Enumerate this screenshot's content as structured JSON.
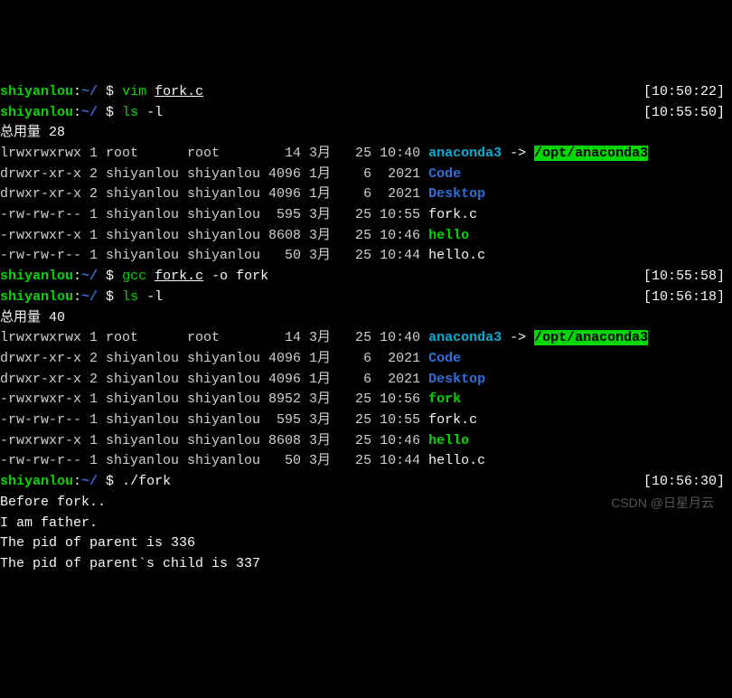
{
  "prompts": [
    {
      "user": "shiyanlou",
      "host": "",
      "path": "~/",
      "cmd": "vim",
      "arg_ul": "fork.c",
      "rest": "",
      "time": "[10:50:22]"
    },
    {
      "user": "shiyanlou",
      "host": "",
      "path": "~/",
      "cmd": "ls",
      "arg_ul": "",
      "rest": " -l",
      "time": "[10:55:50]"
    }
  ],
  "total1": "总用量 28",
  "ls1": [
    {
      "perm": "lrwxrwxrwx",
      "n": "1",
      "own": "root     ",
      "grp": "root     ",
      "size": "  14",
      "mon": "3月 ",
      "day": " 25",
      "tm": "10:40",
      "name": "anaconda3",
      "cls": "cyan",
      "arrow": " -> ",
      "target": "/opt/anaconda3",
      "tcls": "hl"
    },
    {
      "perm": "drwxr-xr-x",
      "n": "2",
      "own": "shiyanlou",
      "grp": "shiyanlou",
      "size": "4096",
      "mon": "1月 ",
      "day": "  6",
      "tm": " 2021",
      "name": "Code",
      "cls": "blue",
      "arrow": "",
      "target": "",
      "tcls": ""
    },
    {
      "perm": "drwxr-xr-x",
      "n": "2",
      "own": "shiyanlou",
      "grp": "shiyanlou",
      "size": "4096",
      "mon": "1月 ",
      "day": "  6",
      "tm": " 2021",
      "name": "Desktop",
      "cls": "blue",
      "arrow": "",
      "target": "",
      "tcls": ""
    },
    {
      "perm": "-rw-rw-r--",
      "n": "1",
      "own": "shiyanlou",
      "grp": "shiyanlou",
      "size": " 595",
      "mon": "3月 ",
      "day": " 25",
      "tm": "10:55",
      "name": "fork.c",
      "cls": "white",
      "arrow": "",
      "target": "",
      "tcls": ""
    },
    {
      "perm": "-rwxrwxr-x",
      "n": "1",
      "own": "shiyanlou",
      "grp": "shiyanlou",
      "size": "8608",
      "mon": "3月 ",
      "day": " 25",
      "tm": "10:46",
      "name": "hello",
      "cls": "green",
      "arrow": "",
      "target": "",
      "tcls": ""
    },
    {
      "perm": "-rw-rw-r--",
      "n": "1",
      "own": "shiyanlou",
      "grp": "shiyanlou",
      "size": "  50",
      "mon": "3月 ",
      "day": " 25",
      "tm": "10:44",
      "name": "hello.c",
      "cls": "white",
      "arrow": "",
      "target": "",
      "tcls": ""
    }
  ],
  "prompts2": [
    {
      "user": "shiyanlou",
      "path": "~/",
      "cmd": "gcc",
      "arg_ul": "fork.c",
      "rest": " -o fork",
      "time": "[10:55:58]"
    },
    {
      "user": "shiyanlou",
      "path": "~/",
      "cmd": "ls",
      "arg_ul": "",
      "rest": " -l",
      "time": "[10:56:18]"
    }
  ],
  "total2": "总用量 40",
  "ls2": [
    {
      "perm": "lrwxrwxrwx",
      "n": "1",
      "own": "root     ",
      "grp": "root     ",
      "size": "  14",
      "mon": "3月 ",
      "day": " 25",
      "tm": "10:40",
      "name": "anaconda3",
      "cls": "cyan",
      "arrow": " -> ",
      "target": "/opt/anaconda3",
      "tcls": "hl"
    },
    {
      "perm": "drwxr-xr-x",
      "n": "2",
      "own": "shiyanlou",
      "grp": "shiyanlou",
      "size": "4096",
      "mon": "1月 ",
      "day": "  6",
      "tm": " 2021",
      "name": "Code",
      "cls": "blue",
      "arrow": "",
      "target": "",
      "tcls": ""
    },
    {
      "perm": "drwxr-xr-x",
      "n": "2",
      "own": "shiyanlou",
      "grp": "shiyanlou",
      "size": "4096",
      "mon": "1月 ",
      "day": "  6",
      "tm": " 2021",
      "name": "Desktop",
      "cls": "blue",
      "arrow": "",
      "target": "",
      "tcls": ""
    },
    {
      "perm": "-rwxrwxr-x",
      "n": "1",
      "own": "shiyanlou",
      "grp": "shiyanlou",
      "size": "8952",
      "mon": "3月 ",
      "day": " 25",
      "tm": "10:56",
      "name": "fork",
      "cls": "green",
      "arrow": "",
      "target": "",
      "tcls": ""
    },
    {
      "perm": "-rw-rw-r--",
      "n": "1",
      "own": "shiyanlou",
      "grp": "shiyanlou",
      "size": " 595",
      "mon": "3月 ",
      "day": " 25",
      "tm": "10:55",
      "name": "fork.c",
      "cls": "white",
      "arrow": "",
      "target": "",
      "tcls": ""
    },
    {
      "perm": "-rwxrwxr-x",
      "n": "1",
      "own": "shiyanlou",
      "grp": "shiyanlou",
      "size": "8608",
      "mon": "3月 ",
      "day": " 25",
      "tm": "10:46",
      "name": "hello",
      "cls": "green",
      "arrow": "",
      "target": "",
      "tcls": ""
    },
    {
      "perm": "-rw-rw-r--",
      "n": "1",
      "own": "shiyanlou",
      "grp": "shiyanlou",
      "size": "  50",
      "mon": "3月 ",
      "day": " 25",
      "tm": "10:44",
      "name": "hello.c",
      "cls": "white",
      "arrow": "",
      "target": "",
      "tcls": ""
    }
  ],
  "prompt3": {
    "user": "shiyanlou",
    "path": "~/",
    "cmd": "",
    "arg_ul": "",
    "rest": "./fork",
    "time": "[10:56:30]"
  },
  "output": [
    "Before fork..",
    "I am father.",
    "The pid of parent is 336",
    "The pid of parent`s child is 337"
  ],
  "watermark": "CSDN @日星月云"
}
